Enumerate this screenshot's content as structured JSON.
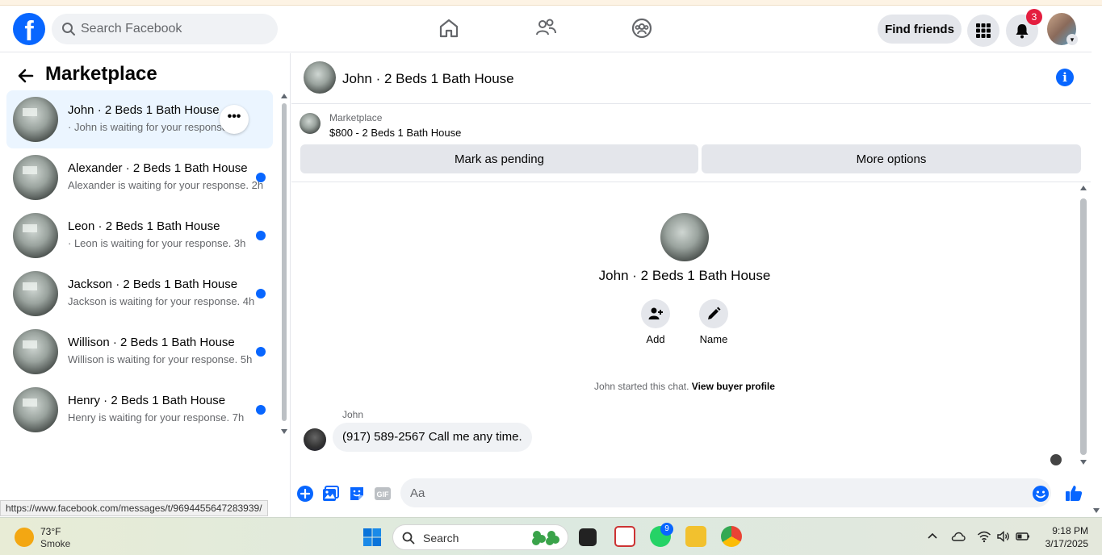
{
  "topbar": {
    "logo_letter": "f",
    "search_placeholder": "Search Facebook",
    "find_friends_label": "Find friends",
    "notification_count": "3"
  },
  "left": {
    "title": "Marketplace",
    "conversations": [
      {
        "name": "John · 2 Beds 1 Bath House",
        "message": "· John is waiting for your response.",
        "unread": false,
        "active": true
      },
      {
        "name": "Alexander · 2 Beds 1 Bath House",
        "message": "Alexander is waiting for your response. 2h",
        "unread": true,
        "active": false
      },
      {
        "name": "Leon · 2 Beds 1 Bath House",
        "message": "· Leon is waiting for your response. 3h",
        "unread": true,
        "active": false
      },
      {
        "name": "Jackson · 2 Beds 1 Bath House",
        "message": "Jackson is waiting for your response. 4h",
        "unread": true,
        "active": false
      },
      {
        "name": "Willison · 2 Beds 1 Bath House",
        "message": "Willison is waiting for your response. 5h",
        "unread": true,
        "active": false
      },
      {
        "name": "Henry · 2 Beds 1 Bath House",
        "message": "Henry is waiting for your response. 7h",
        "unread": true,
        "active": false
      }
    ],
    "more_label": "•••",
    "status_url": "https://www.facebook.com/messages/t/9694455647283939/"
  },
  "chat": {
    "header_title": "John · 2 Beds 1 Bath House",
    "info_label": "i",
    "listing_source": "Marketplace",
    "listing_price": "$800 - 2 Beds 1 Bath House",
    "mark_pending_label": "Mark as pending",
    "more_options_label": "More options",
    "center_name": "John · 2 Beds 1 Bath House",
    "add_label": "Add",
    "name_label": "Name",
    "started_text": "John started this chat.",
    "buyer_profile_link": "View buyer profile",
    "sender_name": "John",
    "message_text": "(917) 589-2567 Call me any time.",
    "composer_placeholder": "Aa"
  },
  "taskbar": {
    "temperature": "73°F",
    "condition": "Smoke",
    "search_label": "Search",
    "whatsapp_badge": "9",
    "time": "9:18 PM",
    "date": "3/17/2025"
  },
  "colors": {
    "accent": "#0866ff",
    "badge_red": "#e41e3f",
    "gray_button": "#e4e6eb"
  }
}
